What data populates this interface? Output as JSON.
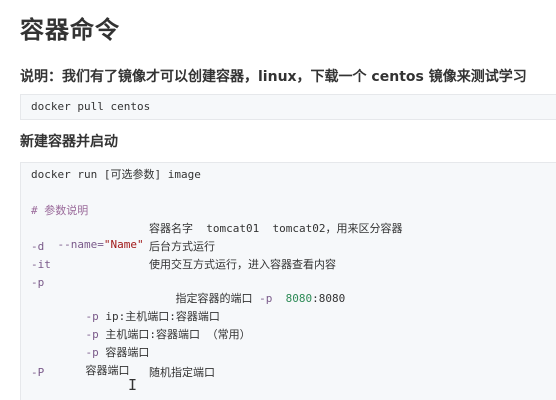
{
  "title": "容器命令",
  "intro": "说明：我们有了镜像才可以创建容器，linux，下载一个 centos 镜像来测试学习",
  "pull_command": "docker pull centos",
  "section_heading": "新建容器并启动",
  "run_block": {
    "command": "docker run [可选参数] image",
    "comment": "# 参数说明",
    "params": [
      {
        "flag_prefix": "--name=",
        "flag_value": "\"Name\"",
        "desc": "容器名字  tomcat01  tomcat02，用来区分容器"
      },
      {
        "flag_prefix": "-d",
        "desc": "后台方式运行"
      },
      {
        "flag_prefix": "-it",
        "desc": "使用交互方式运行，进入容器查看内容"
      },
      {
        "flag_prefix": "-p",
        "desc_prefix": "指定容器的端口 ",
        "desc_flag": "-p",
        "desc_port": "8080",
        "desc_suffix": ":8080"
      }
    ],
    "sub_options": [
      {
        "flag": "-p",
        "text": " ip:主机端口:容器端口"
      },
      {
        "flag": "-p",
        "text": " 主机端口:容器端口 （常用）"
      },
      {
        "flag": "-p",
        "text": " 容器端口"
      },
      {
        "flag": "",
        "text": "容器端口"
      }
    ],
    "last_param": {
      "flag": "-P",
      "desc": "随机指定端口"
    }
  },
  "colors": {
    "code_background": "#f6f8fa",
    "flag": "#7a5a8a",
    "string": "#a01818",
    "comment": "#9a6a9a",
    "number": "#2e8b57"
  },
  "cursor_icon": "text-cursor-icon"
}
